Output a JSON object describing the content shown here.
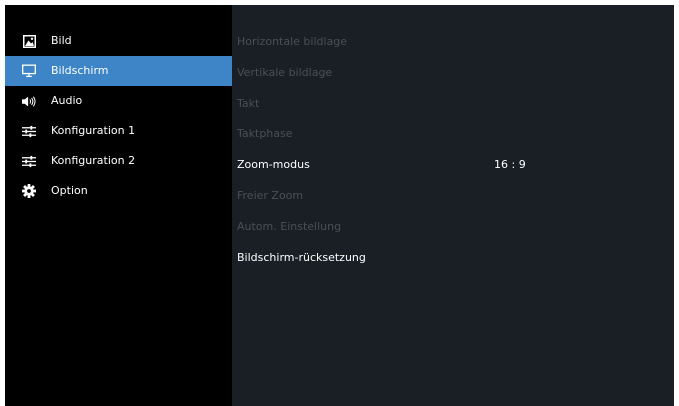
{
  "sidebar": {
    "items": [
      {
        "label": "Bild",
        "icon": "image-icon",
        "selected": false
      },
      {
        "label": "Bildschirm",
        "icon": "monitor-icon",
        "selected": true
      },
      {
        "label": "Audio",
        "icon": "speaker-icon",
        "selected": false
      },
      {
        "label": "Konfiguration 1",
        "icon": "sliders-icon",
        "selected": false
      },
      {
        "label": "Konfiguration 2",
        "icon": "sliders-icon",
        "selected": false
      },
      {
        "label": "Option",
        "icon": "gear-icon",
        "selected": false
      }
    ]
  },
  "settings": {
    "items": [
      {
        "label": "Horizontale bildlage",
        "enabled": false
      },
      {
        "label": "Vertikale bildlage",
        "enabled": false
      },
      {
        "label": "Takt",
        "enabled": false
      },
      {
        "label": "Taktphase",
        "enabled": false
      },
      {
        "label": "Zoom-modus",
        "enabled": true,
        "value": "16 : 9"
      },
      {
        "label": "Freier Zoom",
        "enabled": false
      },
      {
        "label": "Autom. Einstellung",
        "enabled": false
      },
      {
        "label": "Bildschirm-rücksetzung",
        "enabled": true
      }
    ]
  },
  "colors": {
    "sidebar_bg": "#000000",
    "selected_bg": "#3d85c6",
    "content_bg": "#1a1e25",
    "enabled_text": "#ffffff",
    "disabled_text": "#4b4f55"
  }
}
